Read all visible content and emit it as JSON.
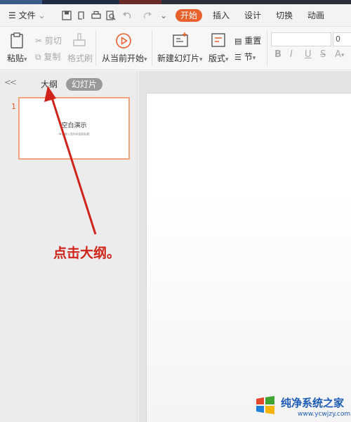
{
  "menubar": {
    "menu_label": "文件",
    "tabs": [
      "开始",
      "插入",
      "设计",
      "切换",
      "动画"
    ],
    "active_tab": "开始",
    "accent_color": "#e8602c"
  },
  "ribbon": {
    "paste": "粘贴",
    "cut": "剪切",
    "copy": "复制",
    "format_painter": "格式刷",
    "play_from_current": "从当前开始",
    "new_slide": "新建幻灯片",
    "layout": "版式",
    "reset": "重置",
    "section": "节",
    "font_size": "0",
    "bold": "B",
    "italic": "I",
    "underline": "U",
    "strike": "S",
    "font_color": "A"
  },
  "left_panel": {
    "tab_outline": "大纲",
    "tab_slides": "幻灯片",
    "collapse_glyph": "<<",
    "slide_number": "1",
    "thumbnail_title": "空白演示",
    "thumbnail_subtitle": "单击输入您的封面副标题"
  },
  "annotation": {
    "text": "点击大纲。",
    "color": "#d0241a"
  },
  "watermark": {
    "name": "纯净系统之家",
    "url": "www.ycwjzy.com"
  }
}
